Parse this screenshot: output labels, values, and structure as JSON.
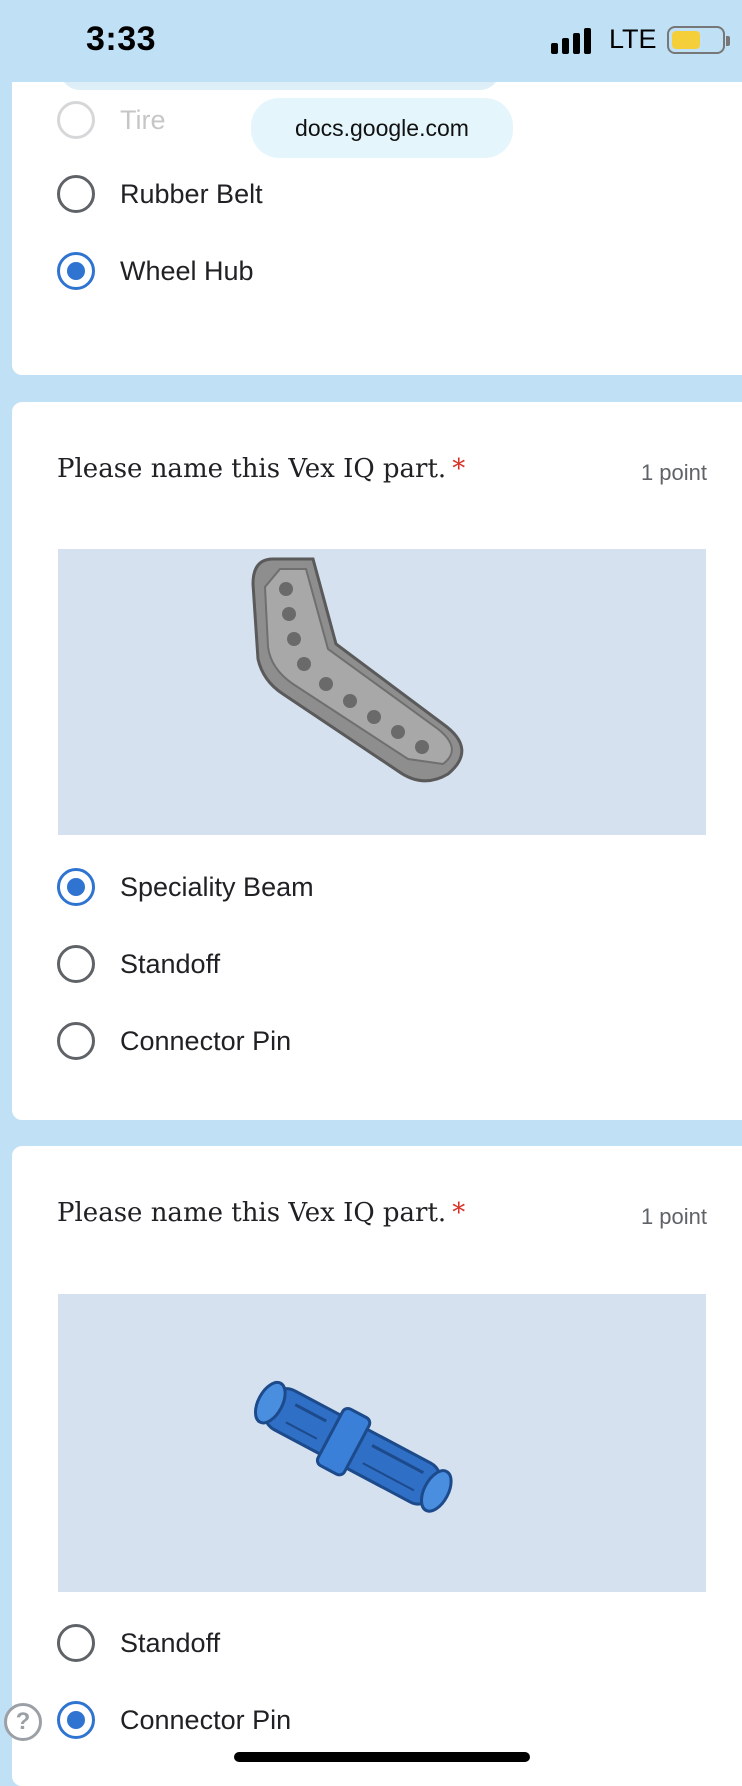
{
  "status_bar": {
    "time": "3:33",
    "network": "LTE",
    "icons": [
      "signal-icon",
      "battery-icon"
    ],
    "battery_color": "#f5cf3a"
  },
  "browser": {
    "url": "docs.google.com"
  },
  "questions": [
    {
      "options": [
        {
          "label": "Tire",
          "selected": false
        },
        {
          "label": "Rubber Belt",
          "selected": false
        },
        {
          "label": "Wheel Hub",
          "selected": true
        }
      ]
    },
    {
      "title": "Please name this Vex IQ part.",
      "required_mark": "*",
      "points": "1 point",
      "image": "speciality-beam-image",
      "options": [
        {
          "label": "Speciality Beam",
          "selected": true
        },
        {
          "label": "Standoff",
          "selected": false
        },
        {
          "label": "Connector Pin",
          "selected": false
        }
      ]
    },
    {
      "title": "Please name this Vex IQ part.",
      "required_mark": "*",
      "points": "1 point",
      "image": "connector-pin-image",
      "options": [
        {
          "label": "Standoff",
          "selected": false
        },
        {
          "label": "Connector Pin",
          "selected": true
        }
      ]
    }
  ],
  "help": "?",
  "colors": {
    "accent": "#2f74d0",
    "background": "#bfe0f5",
    "required": "#d93025"
  }
}
